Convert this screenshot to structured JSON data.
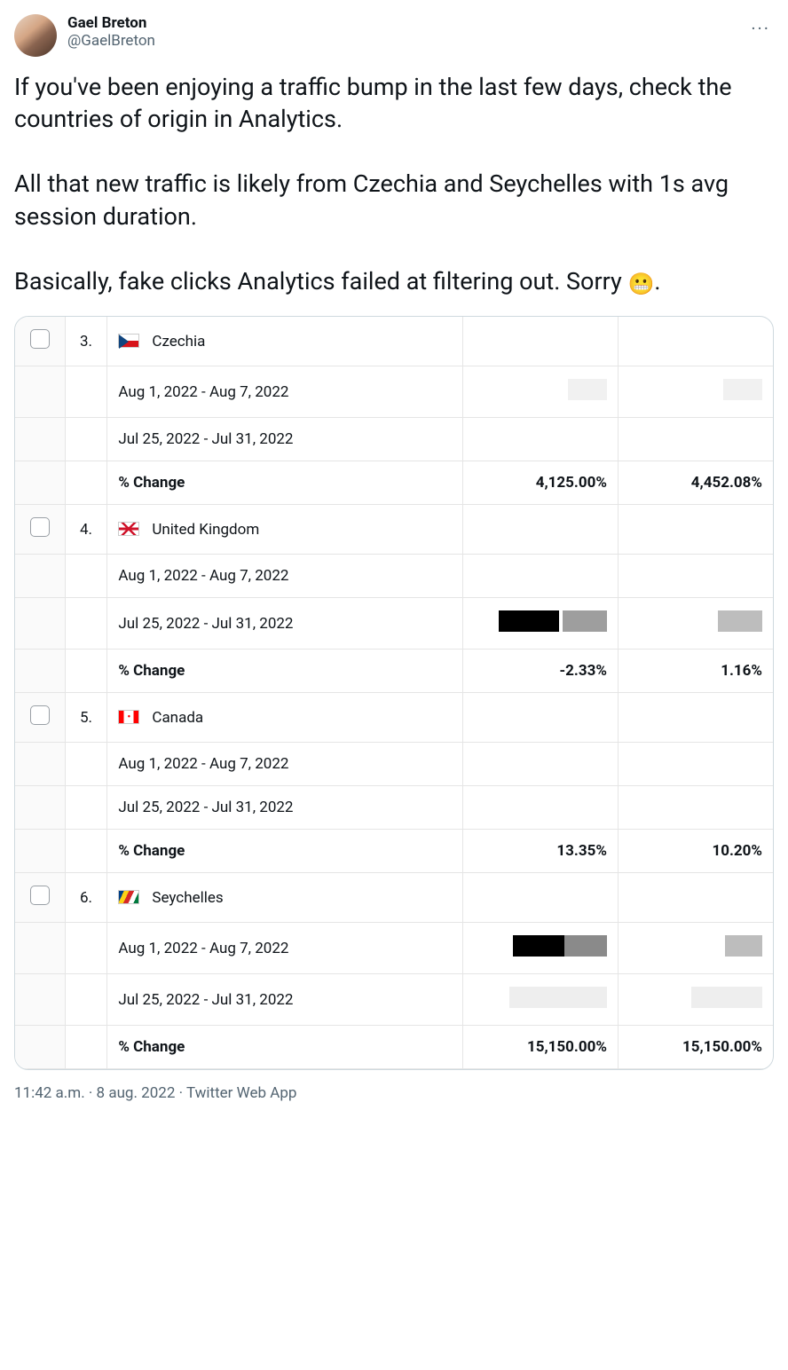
{
  "author": {
    "name": "Gael Breton",
    "handle": "@GaelBreton"
  },
  "tweet_text_line1": "If you've been enjoying a traffic bump in the last few days, check the countries of origin in Analytics.",
  "tweet_text_line2": "All that new traffic is likely from Czechia and Seychelles with 1s avg session duration.",
  "tweet_text_line3a": "Basically, fake clicks Analytics failed at filtering out. Sorry ",
  "tweet_text_line3b": ".",
  "grimace_emoji": "😬",
  "timestamp": "11:42 a.m. · 8 aug. 2022 · Twitter Web App",
  "analytics": {
    "rows": [
      {
        "rank": "3.",
        "country": "Czechia",
        "period1": "Aug 1, 2022 - Aug 7, 2022",
        "period2": "Jul 25, 2022 - Jul 31, 2022",
        "change_label": "% Change",
        "change_v1": "4,125.00%",
        "change_v2": "4,452.08%"
      },
      {
        "rank": "4.",
        "country": "United Kingdom",
        "period1": "Aug 1, 2022 - Aug 7, 2022",
        "period2": "Jul 25, 2022 - Jul 31, 2022",
        "change_label": "% Change",
        "change_v1": "-2.33%",
        "change_v2": "1.16%"
      },
      {
        "rank": "5.",
        "country": "Canada",
        "period1": "Aug 1, 2022 - Aug 7, 2022",
        "period2": "Jul 25, 2022 - Jul 31, 2022",
        "change_label": "% Change",
        "change_v1": "13.35%",
        "change_v2": "10.20%"
      },
      {
        "rank": "6.",
        "country": "Seychelles",
        "period1": "Aug 1, 2022 - Aug 7, 2022",
        "period2": "Jul 25, 2022 - Jul 31, 2022",
        "change_label": "% Change",
        "change_v1": "15,150.00%",
        "change_v2": "15,150.00%"
      }
    ]
  }
}
